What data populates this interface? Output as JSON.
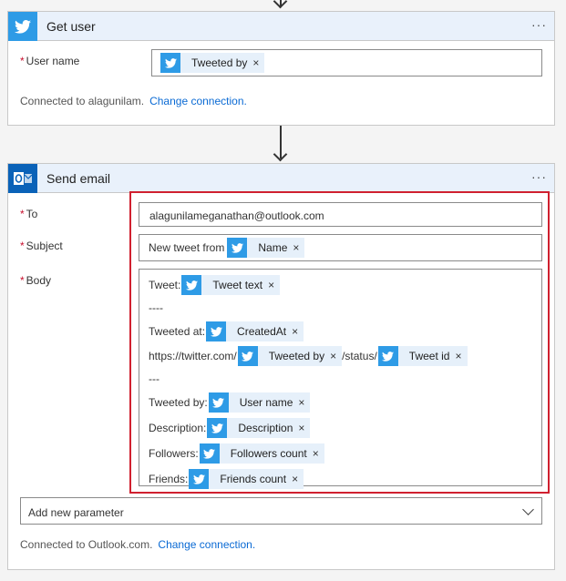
{
  "colors": {
    "twitter_blue": "#2e9be6",
    "outlook_blue": "#0a62b8",
    "header_bg": "#e9f1fb",
    "token_bg": "#e6f0fa",
    "highlight_red": "#d0202f",
    "link": "#0a6ad4"
  },
  "get_user": {
    "title": "Get user",
    "icon": "twitter-icon",
    "menu": "···",
    "user_name_label": "User name",
    "user_name_token": "Tweeted by",
    "connected_text": "Connected to alagunilam.",
    "change_connection": "Change connection."
  },
  "send_email": {
    "title": "Send email",
    "icon": "outlook-icon",
    "menu": "···",
    "to_label": "To",
    "to_value": "alagunilameganathan@outlook.com",
    "subject_label": "Subject",
    "subject_prefix": "New tweet from",
    "subject_token": "Name",
    "body_label": "Body",
    "body": {
      "tweet_label": "Tweet:",
      "tweet_token": "Tweet text",
      "sep1": "----",
      "tweeted_at_label": "Tweeted at:",
      "tweeted_at_token": "CreatedAt",
      "url_prefix": "https://twitter.com/",
      "url_token1": "Tweeted by",
      "url_mid": "/status/",
      "url_token2": "Tweet id",
      "sep2": "---",
      "tweeted_by_label": "Tweeted by:",
      "tweeted_by_token": "User name",
      "description_label": "Description:",
      "description_token": "Description",
      "followers_label": "Followers:",
      "followers_token": "Followers count",
      "friends_label": "Friends:",
      "friends_token": "Friends count"
    },
    "add_param": "Add new parameter",
    "connected_text": "Connected to Outlook.com.",
    "change_connection": "Change connection."
  },
  "token_close": "×",
  "required_marker": "*"
}
